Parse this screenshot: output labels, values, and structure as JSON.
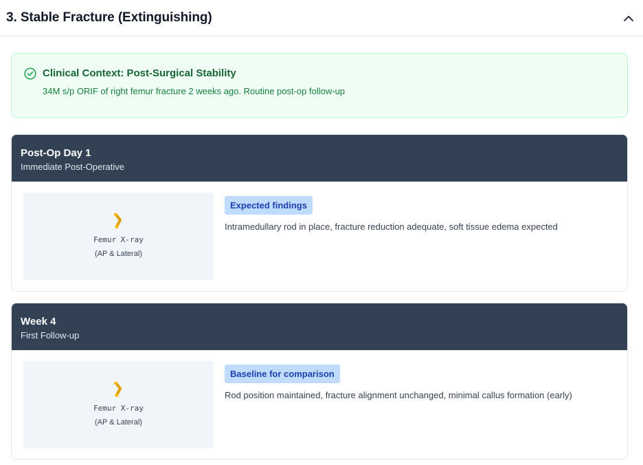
{
  "section": {
    "title": "3. Stable Fracture (Extinguishing)",
    "expanded": true
  },
  "context": {
    "title": "Clinical Context: Post-Surgical Stability",
    "text": "34M s/p ORIF of right femur fracture 2 weeks ago. Routine post-op follow-up",
    "icon": "check-circle-icon",
    "color": "#166534"
  },
  "timeline": [
    {
      "title": "Post-Op Day 1",
      "subtitle": "Immediate Post-Operative",
      "image_label": "Femur X-ray",
      "image_sublabel": "(AP & Lateral)",
      "badge": "Expected findings",
      "findings": "Intramedullary rod in place, fracture reduction adequate, soft tissue edema expected"
    },
    {
      "title": "Week 4",
      "subtitle": "First Follow-up",
      "image_label": "Femur X-ray",
      "image_sublabel": "(AP & Lateral)",
      "badge": "Baseline for comparison",
      "findings": "Rod position maintained, fracture alignment unchanged, minimal callus formation (early)"
    }
  ],
  "colors": {
    "header_bg": "#334155",
    "badge_bg": "#bfdbfe",
    "badge_text": "#1e40af",
    "context_bg": "#f0fdf4"
  }
}
